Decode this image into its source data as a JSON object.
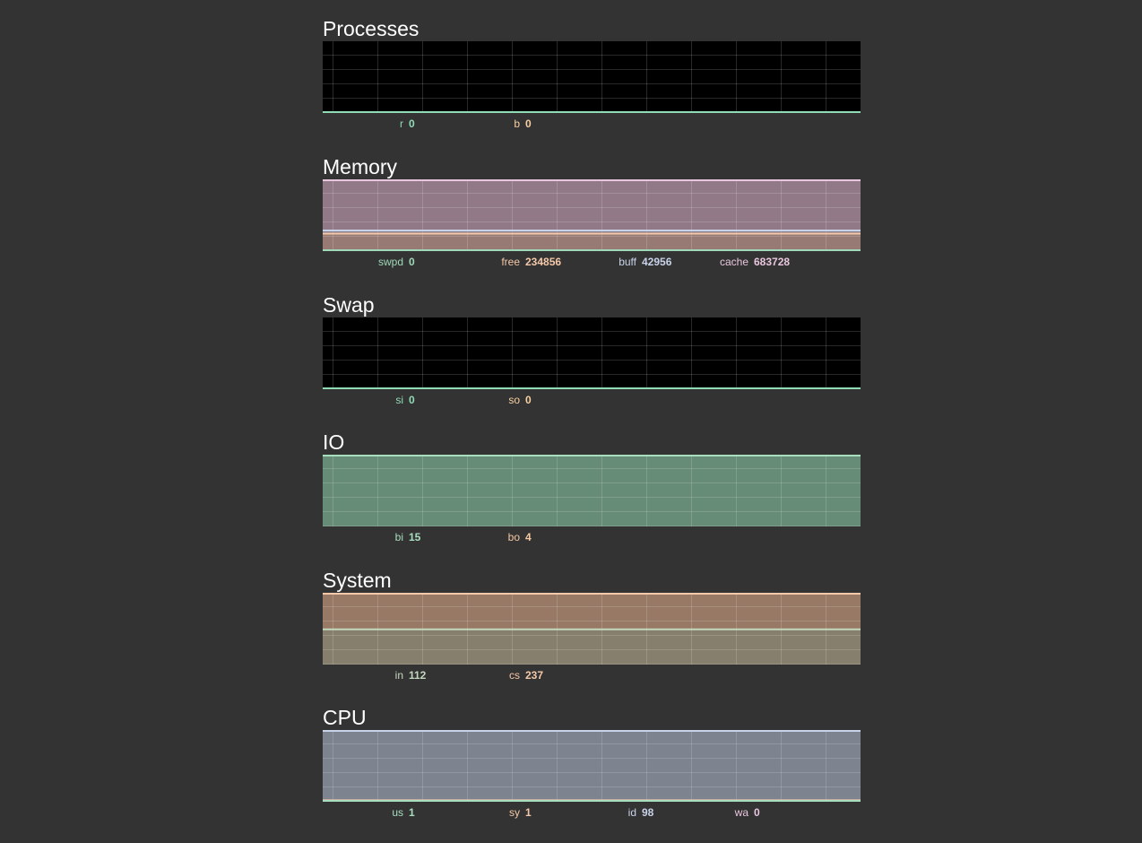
{
  "sections": [
    {
      "title": "Processes",
      "bg": "#000000",
      "series": [
        {
          "label": "r",
          "value": "0",
          "color": "#8FDCB6",
          "fraction": 0
        },
        {
          "label": "b",
          "value": "0",
          "color": "#F7CFA0",
          "fraction": 0
        }
      ]
    },
    {
      "title": "Memory",
      "bg": "#5E4B55",
      "series": [
        {
          "label": "swpd",
          "value": "0",
          "color": "#9ED8B8",
          "fraction": 0
        },
        {
          "label": "free",
          "value": "234856",
          "color": "#F4C8A8",
          "fraction": 0.243
        },
        {
          "label": "buff",
          "value": "42956",
          "color": "#C8D2E8",
          "fraction": 0.044
        },
        {
          "label": "cache",
          "value": "683728",
          "color": "#E8C6DE",
          "fraction": 0.71
        }
      ]
    },
    {
      "title": "Swap",
      "bg": "#000000",
      "series": [
        {
          "label": "si",
          "value": "0",
          "color": "#8FDCB6",
          "fraction": 0
        },
        {
          "label": "so",
          "value": "0",
          "color": "#F7CFA0",
          "fraction": 0
        }
      ]
    },
    {
      "title": "IO",
      "bg": "#3E5A4B",
      "series": [
        {
          "label": "bi",
          "value": "15",
          "color": "#A8DEC0",
          "fraction": 1.0
        },
        {
          "label": "bo",
          "value": "4",
          "color": "#F4C8A0",
          "fraction": 0.27
        }
      ]
    },
    {
      "title": "System",
      "bg": "#5F4A3C",
      "series": [
        {
          "label": "in",
          "value": "112",
          "color": "#C4D8BE",
          "fraction": 0.49
        },
        {
          "label": "cs",
          "value": "237",
          "color": "#F4C8A8",
          "fraction": 1.0
        }
      ]
    },
    {
      "title": "CPU",
      "bg": "#4F535A",
      "series": [
        {
          "label": "us",
          "value": "1",
          "color": "#A8DEC0",
          "fraction": 0.01
        },
        {
          "label": "sy",
          "value": "1",
          "color": "#F4C8A8",
          "fraction": 0.01
        },
        {
          "label": "id",
          "value": "98",
          "color": "#C8D2E8",
          "fraction": 0.98
        },
        {
          "label": "wa",
          "value": "0",
          "color": "#E8C6DE",
          "fraction": 0
        }
      ]
    }
  ]
}
